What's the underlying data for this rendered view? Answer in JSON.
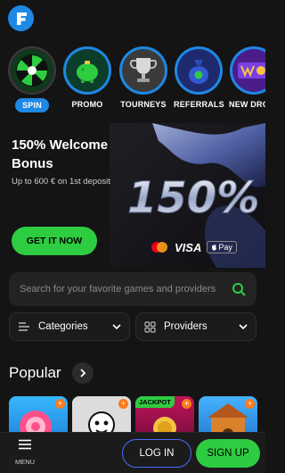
{
  "header": {
    "logo_letter": "F"
  },
  "categories": [
    {
      "label": "SPIN",
      "active": true,
      "icon": "wheel-icon"
    },
    {
      "label": "PROMO",
      "active": false,
      "icon": "piggy-bank-icon"
    },
    {
      "label": "TOURNEYS",
      "active": false,
      "icon": "trophy-icon"
    },
    {
      "label": "REFERRALS",
      "active": false,
      "icon": "money-bag-icon"
    },
    {
      "label": "NEW DROPS",
      "active": false,
      "icon": "wild-cluster-icon"
    }
  ],
  "banner": {
    "title": "150% Welcome Bonus",
    "subtitle": "Up to 600 € on 1st deposit",
    "big_text": "150%",
    "cta_label": "GET IT NOW",
    "payment_visa": "VISA",
    "payment_apple": "Pay"
  },
  "search": {
    "placeholder": "Search for your favorite games and providers"
  },
  "filters": {
    "categories_label": "Categories",
    "providers_label": "Providers"
  },
  "popular": {
    "title": "Popular"
  },
  "games": [
    {
      "name": "candy-game",
      "badge": ""
    },
    {
      "name": "cartoon-game",
      "badge": ""
    },
    {
      "name": "jackpot-game",
      "badge": "JACKPOT"
    },
    {
      "name": "dog-house-game",
      "badge": ""
    }
  ],
  "bottom_nav": {
    "menu_label": "MENU",
    "login_label": "LOG IN",
    "signup_label": "SIGN UP"
  },
  "colors": {
    "accent_blue": "#1e88e5",
    "accent_green": "#2ecc40",
    "background": "#141414"
  }
}
